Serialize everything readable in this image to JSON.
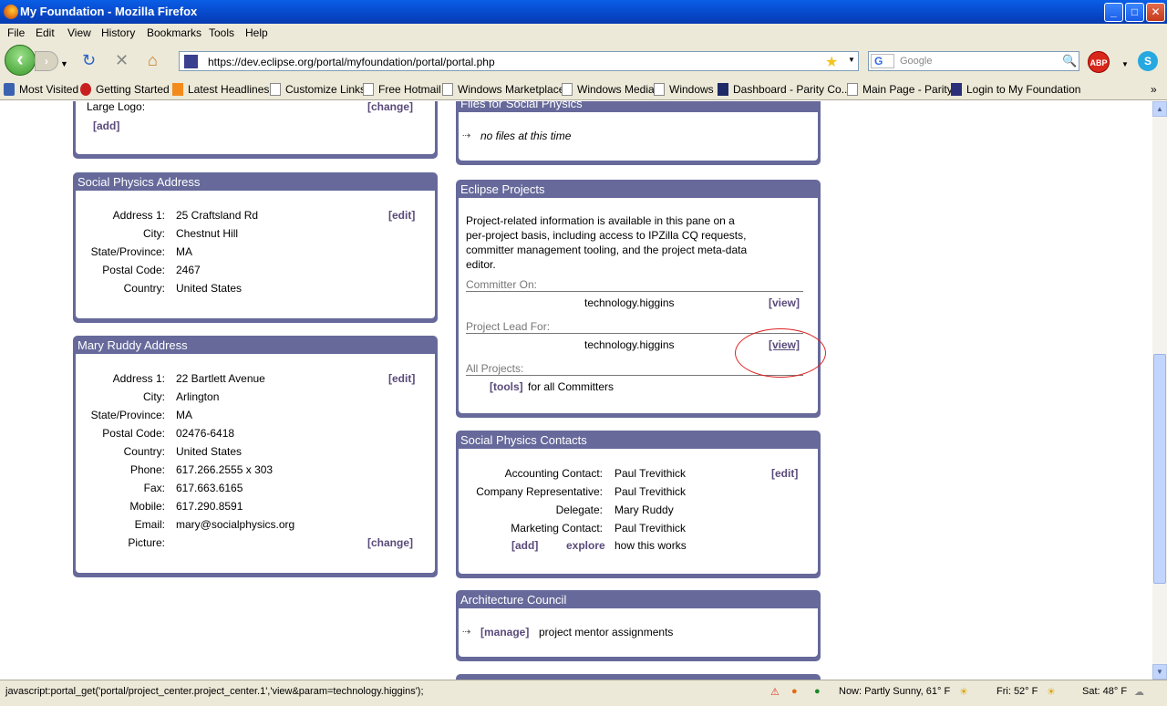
{
  "window": {
    "title": "My Foundation - Mozilla Firefox"
  },
  "menu": [
    "File",
    "Edit",
    "View",
    "History",
    "Bookmarks",
    "Tools",
    "Help"
  ],
  "nav": {
    "url": "https://dev.eclipse.org/portal/myfoundation/portal/portal.php",
    "search_placeholder": "Google",
    "search_engine": "G",
    "adblock": "ABP"
  },
  "bookmarks": [
    "Most Visited",
    "Getting Started",
    "Latest Headlines",
    "Customize Links",
    "Free Hotmail",
    "Windows Marketplace",
    "Windows Media",
    "Windows",
    "Dashboard - Parity Co...",
    "Main Page - Parity",
    "Login to My Foundation"
  ],
  "logo_panel": {
    "label": "Large Logo:",
    "change": "[change]",
    "add": "[add]"
  },
  "sp_address": {
    "title": "Social Physics Address",
    "edit": "[edit]",
    "rows": [
      {
        "label": "Address 1:",
        "value": "25 Craftsland Rd"
      },
      {
        "label": "City:",
        "value": "Chestnut Hill"
      },
      {
        "label": "State/Province:",
        "value": "MA"
      },
      {
        "label": "Postal Code:",
        "value": "2467"
      },
      {
        "label": "Country:",
        "value": "United States"
      }
    ]
  },
  "mr_address": {
    "title": "Mary Ruddy Address",
    "edit": "[edit]",
    "change": "[change]",
    "rows": [
      {
        "label": "Address 1:",
        "value": "22 Bartlett Avenue"
      },
      {
        "label": "City:",
        "value": "Arlington"
      },
      {
        "label": "State/Province:",
        "value": "MA"
      },
      {
        "label": "Postal Code:",
        "value": "02476-6418"
      },
      {
        "label": "Country:",
        "value": "United States"
      },
      {
        "label": "Phone:",
        "value": "617.266.2555 x 303"
      },
      {
        "label": "Fax:",
        "value": "617.663.6165"
      },
      {
        "label": "Mobile:",
        "value": "617.290.8591"
      },
      {
        "label": "Email:",
        "value": "mary@socialphysics.org"
      },
      {
        "label": "Picture:",
        "value": ""
      }
    ]
  },
  "files": {
    "title": "Files for Social Physics",
    "empty": "no files at this time"
  },
  "projects": {
    "title": "Eclipse Projects",
    "desc": [
      "Project-related information is available in this pane on a",
      "per-project basis, including access to IPZilla CQ requests,",
      "committer management tooling, and the project meta-data",
      "editor."
    ],
    "committer_on": "Committer On:",
    "committer_project": "technology.higgins",
    "view": "[view]",
    "lead_for": "Project Lead For:",
    "lead_project": "technology.higgins",
    "all_projects": "All Projects:",
    "tools": "[tools]",
    "tools_text": "for all Committers"
  },
  "contacts": {
    "title": "Social Physics Contacts",
    "edit": "[edit]",
    "rows": [
      {
        "label": "Accounting Contact:",
        "value": "Paul Trevithick"
      },
      {
        "label": "Company Representative:",
        "value": "Paul Trevithick"
      },
      {
        "label": "Delegate:",
        "value": "Mary Ruddy"
      },
      {
        "label": "Marketing Contact:",
        "value": "Paul Trevithick"
      }
    ],
    "add": "[add]",
    "explore": "explore",
    "explore_text": "how this works"
  },
  "arch": {
    "title": "Architecture Council",
    "manage": "[manage]",
    "text": "project mentor assignments"
  },
  "status": {
    "text": "javascript:portal_get('portal/project_center.project_center.1','view&param=technology.higgins');",
    "now": "Now: Partly Sunny, 61° F",
    "fri": "Fri: 52° F",
    "sat": "Sat: 48° F"
  }
}
